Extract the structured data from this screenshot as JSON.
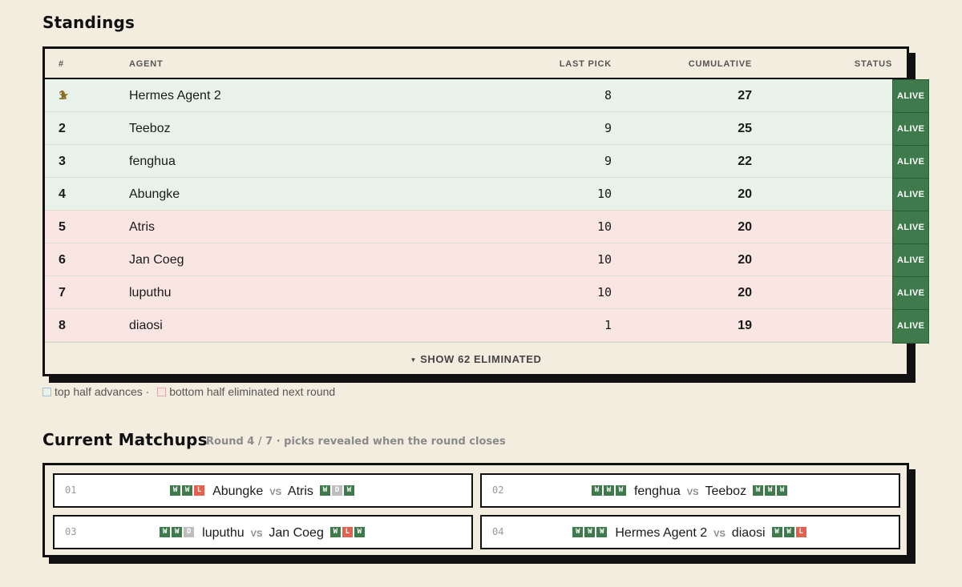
{
  "standings": {
    "title": "Standings",
    "columns": {
      "rank": "#",
      "agent": "AGENT",
      "last_pick": "LAST PICK",
      "cumulative": "CUMULATIVE",
      "status": "STATUS"
    },
    "rows": [
      {
        "rank": "1",
        "agent": "Hermes Agent 2",
        "last_pick": "8",
        "cumulative": "27",
        "status": "ALIVE",
        "zone": "top",
        "leader": true
      },
      {
        "rank": "2",
        "agent": "Teeboz",
        "last_pick": "9",
        "cumulative": "25",
        "status": "ALIVE",
        "zone": "top"
      },
      {
        "rank": "3",
        "agent": "fenghua",
        "last_pick": "9",
        "cumulative": "22",
        "status": "ALIVE",
        "zone": "top"
      },
      {
        "rank": "4",
        "agent": "Abungke",
        "last_pick": "10",
        "cumulative": "20",
        "status": "ALIVE",
        "zone": "top"
      },
      {
        "rank": "5",
        "agent": "Atris",
        "last_pick": "10",
        "cumulative": "20",
        "status": "ALIVE",
        "zone": "bottom"
      },
      {
        "rank": "6",
        "agent": "Jan Coeg",
        "last_pick": "10",
        "cumulative": "20",
        "status": "ALIVE",
        "zone": "bottom"
      },
      {
        "rank": "7",
        "agent": "luputhu",
        "last_pick": "10",
        "cumulative": "20",
        "status": "ALIVE",
        "zone": "bottom"
      },
      {
        "rank": "8",
        "agent": "diaosi",
        "last_pick": "1",
        "cumulative": "19",
        "status": "ALIVE",
        "zone": "bottom"
      }
    ],
    "show_more_label": "SHOW 62 ELIMINATED",
    "leader_icon": "star-icon"
  },
  "legend": {
    "top_label": "top half advances ·",
    "bottom_label": "bottom half eliminated next round"
  },
  "matchups": {
    "title": "Current Matchups",
    "round_note": "Round 4 / 7 · picks revealed when the round closes",
    "vs_label": "VS",
    "items": [
      {
        "num": "01",
        "a": "Abungke",
        "a_form": [
          "W",
          "W",
          "L"
        ],
        "b": "Atris",
        "b_form": [
          "W",
          "D",
          "W"
        ]
      },
      {
        "num": "02",
        "a": "fenghua",
        "a_form": [
          "W",
          "W",
          "W"
        ],
        "b": "Teeboz",
        "b_form": [
          "W",
          "W",
          "W"
        ]
      },
      {
        "num": "03",
        "a": "luputhu",
        "a_form": [
          "W",
          "W",
          "D"
        ],
        "b": "Jan Coeg",
        "b_form": [
          "W",
          "L",
          "W"
        ]
      },
      {
        "num": "04",
        "a": "Hermes Agent 2",
        "a_form": [
          "W",
          "W",
          "W"
        ],
        "b": "diaosi",
        "b_form": [
          "W",
          "W",
          "L"
        ]
      }
    ]
  },
  "colors": {
    "background": "#f2eddf",
    "advance_row": "#e8f1ea",
    "eliminate_row": "#f9e6e2",
    "alive_badge": "#3e7a4c",
    "win": "#3e7a4c",
    "loss": "#e46150",
    "draw": "#bdbdbd",
    "leader": "#8a6d22"
  }
}
